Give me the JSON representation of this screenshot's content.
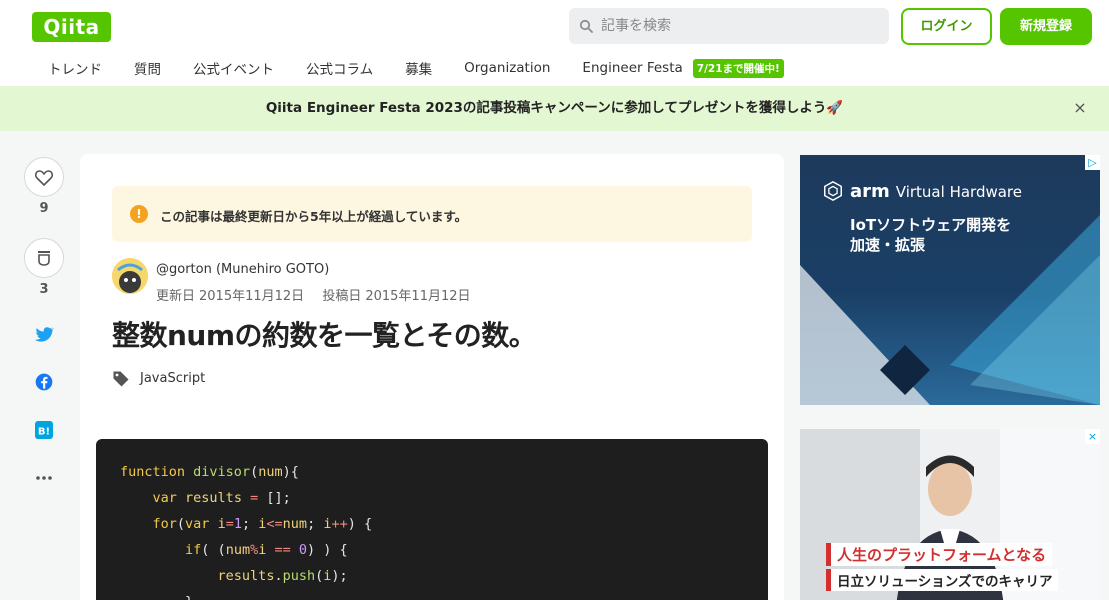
{
  "header": {
    "logo": "Qiita",
    "search_placeholder": "記事を検索",
    "login_label": "ログイン",
    "signup_label": "新規登録"
  },
  "nav": {
    "items": [
      "トレンド",
      "質問",
      "公式イベント",
      "公式コラム",
      "募集",
      "Organization",
      "Engineer Festa"
    ],
    "badge": "7/21まで開催中!"
  },
  "banner": {
    "text": "Qiita Engineer Festa 2023の記事投稿キャンペーンに参加してプレゼントを獲得しよう🚀",
    "close": "×"
  },
  "rail": {
    "like_count": "9",
    "stock_count": "3"
  },
  "article": {
    "notice": "この記事は最終更新日から5年以上が経過しています。",
    "author": "@gorton (Munehiro GOTO)",
    "updated_label": "更新日",
    "updated_date": "2015年11月12日",
    "posted_label": "投稿日",
    "posted_date": "2015年11月12日",
    "title": "整数numの約数を一覧とその数。",
    "tag": "JavaScript"
  },
  "code": {
    "lines": [
      "function divisor(num){",
      "    var results = [];",
      "    for(var i=1; i<=num; i++) {",
      "        if( (num%i == 0) ) {",
      "            results.push(i);",
      "        }"
    ]
  },
  "ads": {
    "ad1_brand": "arm",
    "ad1_product": "Virtual Hardware",
    "ad1_line1": "IoTソフトウェア開発を",
    "ad1_line2": "加速・拡張",
    "ad2_line1": "人生のプラットフォームとなる",
    "ad2_line2": "日立ソリューションズでのキャリア"
  },
  "colors": {
    "brand": "#55c500",
    "banner_bg": "#e3f7d3",
    "notice_bg": "#fdf6e1"
  }
}
